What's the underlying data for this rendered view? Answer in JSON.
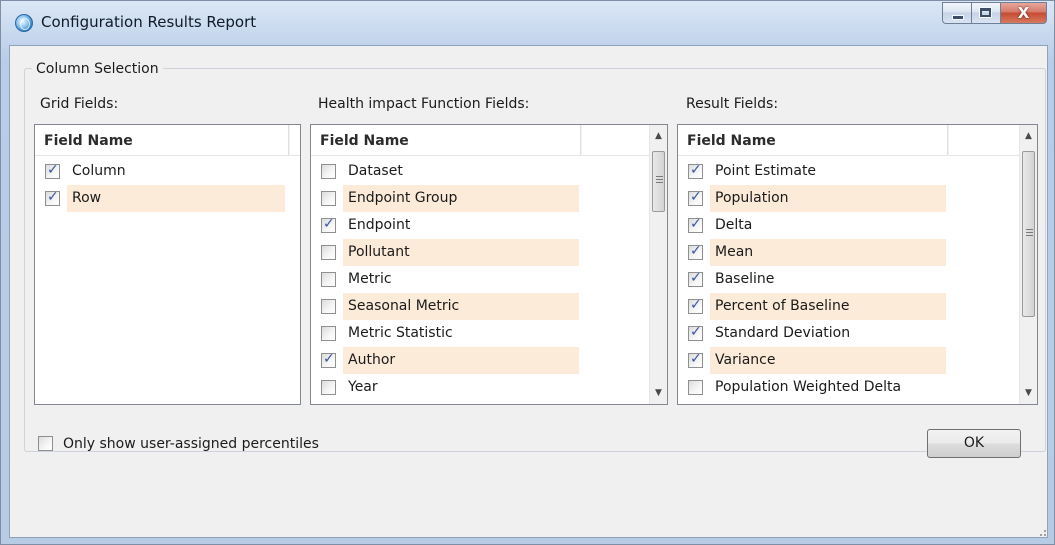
{
  "window": {
    "title": "Configuration Results Report",
    "icon": "globe-app-icon",
    "minimize_icon": "minimize-icon",
    "maximize_icon": "maximize-icon",
    "close_glyph": "X"
  },
  "group": {
    "title": "Column Selection"
  },
  "grid_fields": {
    "label": "Grid Fields:",
    "column_header": "Field Name",
    "rows": [
      {
        "name": "Column",
        "checked": true
      },
      {
        "name": "Row",
        "checked": true
      }
    ]
  },
  "hif_fields": {
    "label": "Health impact Function Fields:",
    "column_header": "Field Name",
    "rows": [
      {
        "name": "Dataset",
        "checked": false
      },
      {
        "name": "Endpoint Group",
        "checked": false
      },
      {
        "name": "Endpoint",
        "checked": true
      },
      {
        "name": "Pollutant",
        "checked": false
      },
      {
        "name": "Metric",
        "checked": false
      },
      {
        "name": "Seasonal Metric",
        "checked": false
      },
      {
        "name": "Metric Statistic",
        "checked": false
      },
      {
        "name": "Author",
        "checked": true
      },
      {
        "name": "Year",
        "checked": false
      }
    ]
  },
  "result_fields": {
    "label": "Result Fields:",
    "column_header": "Field Name",
    "rows": [
      {
        "name": "Point Estimate",
        "checked": true
      },
      {
        "name": "Population",
        "checked": true
      },
      {
        "name": "Delta",
        "checked": true
      },
      {
        "name": "Mean",
        "checked": true
      },
      {
        "name": "Baseline",
        "checked": true
      },
      {
        "name": "Percent of Baseline",
        "checked": true
      },
      {
        "name": "Standard Deviation",
        "checked": true
      },
      {
        "name": "Variance",
        "checked": true
      },
      {
        "name": "Population Weighted Delta",
        "checked": false
      }
    ]
  },
  "footer": {
    "percentiles_label": "Only show user-assigned percentiles",
    "percentiles_checked": false,
    "ok_label": "OK"
  },
  "colors": {
    "row_highlight": "#fdebd9",
    "check_color": "#3955a0",
    "title_bar": "#c7d8ee",
    "close_button": "#c54a34"
  }
}
